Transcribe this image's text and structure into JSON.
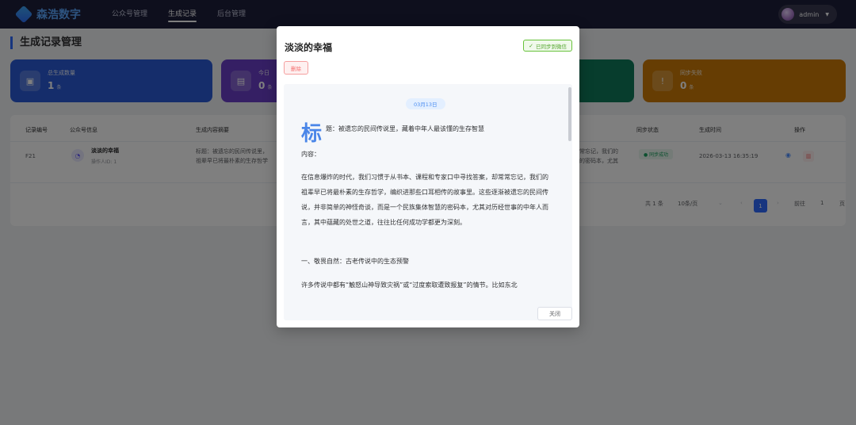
{
  "brand": {
    "name": "森浩数字"
  },
  "nav": {
    "items": [
      "公众号管理",
      "生成记录",
      "后台管理"
    ],
    "active_index": 1
  },
  "user": {
    "name": "admin"
  },
  "page": {
    "title": "生成记录管理"
  },
  "stats": [
    {
      "label": "总生成数量",
      "value": "1",
      "unit": "条",
      "color": "#2a5bd7"
    },
    {
      "label": "今日",
      "value": "0",
      "unit": "条",
      "color": "#6a3fc9"
    },
    {
      "label": "",
      "value": "",
      "unit": "",
      "color": "#0f7a5a"
    },
    {
      "label": "同步失败",
      "value": "0",
      "unit": "条",
      "color": "#cc7a06"
    }
  ],
  "table": {
    "headers": [
      "记录编号",
      "公众号信息",
      "生成内容摘要",
      "同步状态",
      "生成时间",
      "操作"
    ],
    "row": {
      "id": "F21",
      "account": "淡淡的幸福",
      "operator": "操作人ID: 1",
      "summary_1": "标题：被遗忘的民间传说里，",
      "summary_2": "祖辈早已将最朴素的生存哲学",
      "summary_right_1": "常忘记，我们的",
      "summary_right_2": "的密码本，尤其",
      "sync_status": "同步成功",
      "time": "2026-03-13 16:35:19"
    }
  },
  "pagination": {
    "total": "共 1 条",
    "page_size": "10条/页",
    "current": "1",
    "goto_label": "前往",
    "goto_value": "1",
    "page_suffix": "页"
  },
  "modal": {
    "title": "淡淡的幸福",
    "sync_tag": "已同步到微信",
    "delete_label": "删除",
    "date": "03月13日",
    "title_cap": "标",
    "title_rest": "题：被遗忘的民间传说里，藏着中年人最该懂的生存智慧",
    "content_label": "内容：",
    "paragraphs": [
      "在信息爆炸的时代，我们习惯于从书本、课程和专家口中寻找答案，却常常忘记，我们的祖辈早已将最朴素的生存哲学，编织进那些口耳相传的故事里。这些逐渐被遗忘的民间传说，并非简单的神怪奇谈，而是一个民族集体智慧的密码本，尤其对历经世事的中年人而言，其中蕴藏的处世之道，往往比任何成功学都更为深刻。",
      "一、敬畏自然：古老传说中的生态预警",
      "许多传说中都有“触怒山神导致灾祸”或“过度索取遭致报复”的情节。比如东北"
    ],
    "close_label": "关闭"
  }
}
